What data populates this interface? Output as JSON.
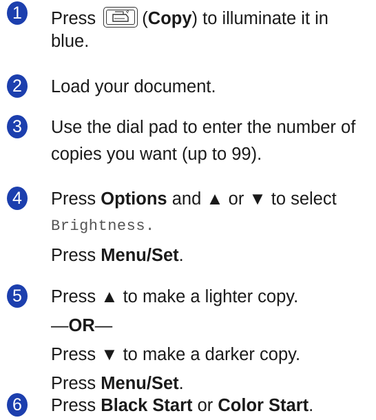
{
  "steps": [
    {
      "number": "1",
      "press": "Press",
      "copy_label": "Copy",
      "paren_open": "(",
      "paren_close": ")",
      "rest_line1": "to illuminate it in",
      "line2": "blue."
    },
    {
      "number": "2",
      "text": "Load your document."
    },
    {
      "number": "3",
      "line1": "Use the dial pad to enter the number of",
      "line2": "copies you want (up to 99)."
    },
    {
      "number": "4",
      "press": "Press",
      "options": "Options",
      "mid": "and ▲ or ▼ to select",
      "brightness": "Brightness.",
      "press2": "Press",
      "menu_set": "Menu/Set",
      "period": "."
    },
    {
      "number": "5",
      "line1": "Press ▲ to make a lighter copy.",
      "dash_left": "—",
      "or": "OR",
      "dash_right": "—",
      "line3": "Press ▼ to make a darker copy.",
      "press2": "Press",
      "menu_set": "Menu/Set",
      "period": "."
    },
    {
      "number": "6",
      "press": "Press",
      "black_start": "Black Start",
      "or": "or",
      "color_start": "Color Start",
      "period": "."
    }
  ],
  "icons": {
    "copy_key": "copy-key-icon"
  }
}
